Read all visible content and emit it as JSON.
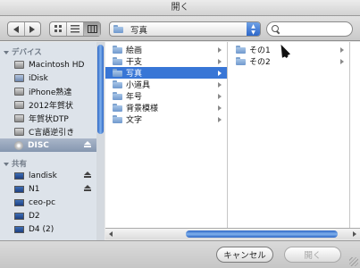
{
  "window": {
    "title": "開く"
  },
  "toolbar": {
    "location": "写真",
    "search": {
      "value": "",
      "placeholder": ""
    }
  },
  "sidebar": {
    "devices_header": "デバイス",
    "devices": [
      {
        "label": "Macintosh HD",
        "icon": "hard-drive-icon"
      },
      {
        "label": "iDisk",
        "icon": "idisk-icon"
      },
      {
        "label": "iPhone熟達",
        "icon": "hard-drive-icon"
      },
      {
        "label": "2012年賀状",
        "icon": "hard-drive-icon"
      },
      {
        "label": "年賀状DTP",
        "icon": "hard-drive-icon"
      },
      {
        "label": "C言語逆引き",
        "icon": "hard-drive-icon"
      },
      {
        "label": "DISC",
        "icon": "disc-icon",
        "selected": true
      }
    ],
    "shared_header": "共有",
    "shared": [
      {
        "label": "landisk",
        "icon": "network-computer-icon"
      },
      {
        "label": "N1",
        "icon": "network-computer-icon"
      },
      {
        "label": "ceo-pc",
        "icon": "network-computer-icon"
      },
      {
        "label": "D2",
        "icon": "network-computer-icon"
      },
      {
        "label": "D4 (2)",
        "icon": "network-computer-icon"
      }
    ]
  },
  "browser": {
    "column1": [
      "絵画",
      "干支",
      "写真",
      "小道具",
      "年号",
      "背景模様",
      "文字"
    ],
    "column1_selected": "写真",
    "column2": [
      "その1",
      "その2"
    ]
  },
  "footer": {
    "cancel_label": "キャンセル",
    "open_label": "開く"
  },
  "colors": {
    "selection": "#3876d6",
    "sidebar_bg": "#dde3ea",
    "scroll_thumb": "#2d66c5"
  }
}
